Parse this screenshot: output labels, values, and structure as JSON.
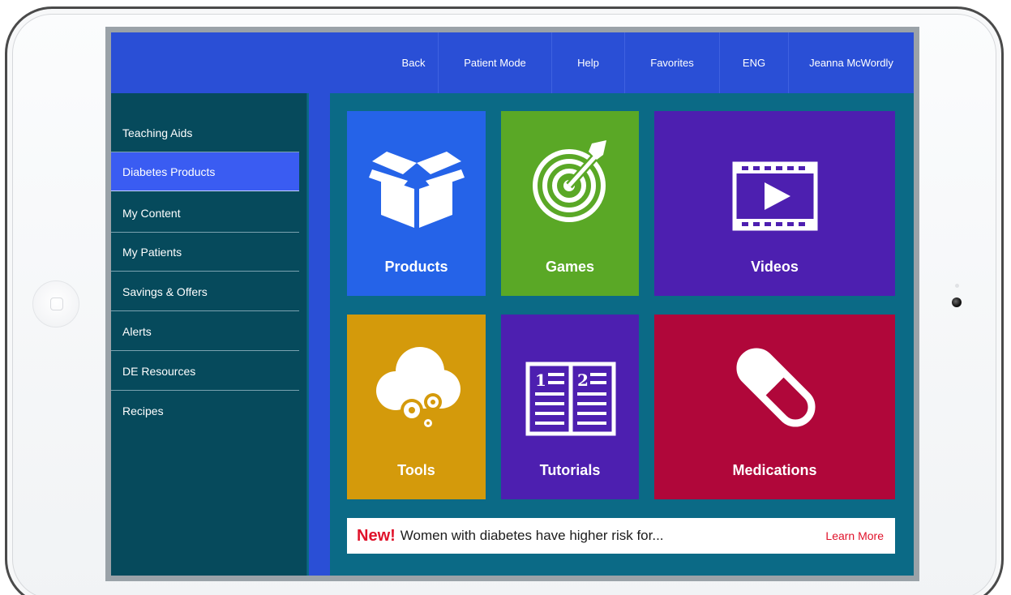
{
  "topbar": {
    "nav": [
      "Back",
      "Patient Mode",
      "Help",
      "Favorites",
      "ENG",
      "Jeanna McWordly"
    ]
  },
  "sidebar": {
    "items": [
      {
        "label": "Teaching Aids"
      },
      {
        "label": "Diabetes Products"
      },
      {
        "label": "My Content"
      },
      {
        "label": "My Patients"
      },
      {
        "label": "Savings & Offers"
      },
      {
        "label": "Alerts"
      },
      {
        "label": "DE Resources"
      },
      {
        "label": "Recipes"
      }
    ],
    "active": "Diabetes Products"
  },
  "tiles": [
    {
      "label": "Products",
      "icon": "box-icon",
      "color": "#2563e8"
    },
    {
      "label": "Games",
      "icon": "target-icon",
      "color": "#5aa826"
    },
    {
      "label": "Videos",
      "icon": "video-icon",
      "color": "#4d1fb0"
    },
    {
      "label": "Tools",
      "icon": "cloud-gears-icon",
      "color": "#d49a0b"
    },
    {
      "label": "Tutorials",
      "icon": "book-icon",
      "color": "#4d1fb0"
    },
    {
      "label": "Medications",
      "icon": "pill-icon",
      "color": "#b0073a"
    }
  ],
  "news": {
    "badge": "New!",
    "headline": "Women with diabetes have higher risk for...",
    "link": "Learn More"
  },
  "colors": {
    "topbar": "#2a4fd6",
    "sidebar": "#064a5c",
    "active_item": "#3a5cf2",
    "content_bg": "#0b6a86",
    "alert_red": "#e0122a"
  }
}
